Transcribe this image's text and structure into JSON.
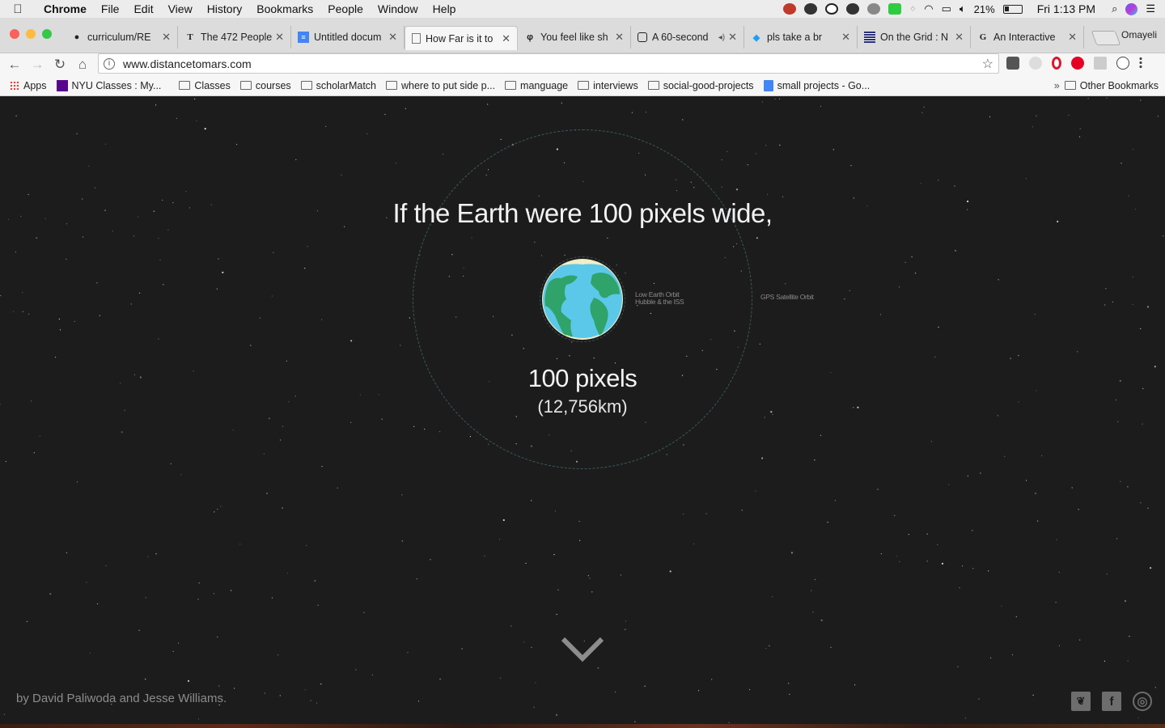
{
  "menubar": {
    "app": "Chrome",
    "items": [
      "File",
      "Edit",
      "View",
      "History",
      "Bookmarks",
      "People",
      "Window",
      "Help"
    ],
    "battery": "21%",
    "clock": "Fri 1:13 PM"
  },
  "tabs": [
    {
      "label": "curriculum/RE",
      "icon": "github-icon"
    },
    {
      "label": "The 472 People",
      "icon": "nyt-icon"
    },
    {
      "label": "Untitled docum",
      "icon": "docs-icon"
    },
    {
      "label": "How Far is it to",
      "icon": "page-icon",
      "active": true
    },
    {
      "label": "You feel like sh",
      "icon": "quora-icon"
    },
    {
      "label": "A 60-second",
      "icon": "codepen-icon"
    },
    {
      "label": "pls take a br",
      "icon": "twitter-icon"
    },
    {
      "label": "On the Grid : N",
      "icon": "grid-icon"
    },
    {
      "label": "An Interactive",
      "icon": "g-icon"
    }
  ],
  "profile": "Omayeli",
  "address": {
    "url": "www.distancetomars.com"
  },
  "bookmarks": [
    {
      "label": "Apps",
      "type": "apps"
    },
    {
      "label": "NYU Classes : My...",
      "type": "purple"
    },
    {
      "label": "Classes",
      "type": "folder"
    },
    {
      "label": "courses",
      "type": "folder"
    },
    {
      "label": "scholarMatch",
      "type": "folder"
    },
    {
      "label": "where to put side p...",
      "type": "folder"
    },
    {
      "label": "manguage",
      "type": "folder"
    },
    {
      "label": "interviews",
      "type": "folder"
    },
    {
      "label": "social-good-projects",
      "type": "folder"
    },
    {
      "label": "small projects - Go...",
      "type": "doc"
    }
  ],
  "bookmarks_more": "»",
  "other_bookmarks": "Other Bookmarks",
  "page": {
    "headline": "If the Earth were 100 pixels wide,",
    "leo_label_1": "Low Earth Orbit",
    "leo_label_2": "Hubble & the ISS",
    "gps_label": "GPS Satellite Orbit",
    "pixels": "100 pixels",
    "km": "(12,756km)",
    "credits": "by David Paliwoda and Jesse Williams."
  },
  "colors": {
    "background": "#1c1c1c",
    "ocean": "#5bc8ea",
    "land": "#2fa36a",
    "ice": "#f3eec5"
  }
}
